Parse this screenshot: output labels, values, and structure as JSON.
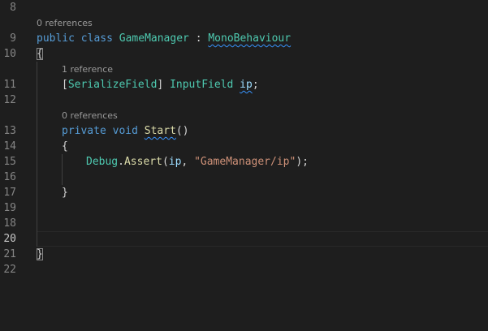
{
  "editor": {
    "colors": {
      "background": "#1e1e1e",
      "line_number": "#858585",
      "keyword": "#569cd6",
      "type": "#4ec9b0",
      "function": "#dcdcaa",
      "string": "#ce9178",
      "variable": "#9cdcfe",
      "codelens": "#999999",
      "squiggle": "#3794ff"
    },
    "line_numbers": [
      "8",
      "9",
      "10",
      "11",
      "12",
      "13",
      "14",
      "15",
      "16",
      "17",
      "18",
      "19",
      "20",
      "21",
      "22"
    ],
    "current_line": "20",
    "codelens": {
      "class": "0 references",
      "field": "1 reference",
      "method": "0 references"
    },
    "code": {
      "l9": {
        "kw1": "public",
        "kw2": "class",
        "name": "GameManager",
        "colon": ":",
        "base": "MonoBehaviour"
      },
      "l10": {
        "text": "{"
      },
      "l11": {
        "lb": "[",
        "attr": "SerializeField",
        "rb": "]",
        "type": "InputField",
        "name": "ip",
        "semi": ";"
      },
      "l13": {
        "kw1": "private",
        "kw2": "void",
        "name": "Start",
        "parens": "()"
      },
      "l14": {
        "text": "{"
      },
      "l15": {
        "cls": "Debug",
        "dot": ".",
        "method": "Assert",
        "open": "(",
        "arg": "ip",
        "comma": ", ",
        "str": "\"GameManager/ip\"",
        "close": ");"
      },
      "l17": {
        "text": "}"
      },
      "l21": {
        "text": "}"
      }
    }
  }
}
